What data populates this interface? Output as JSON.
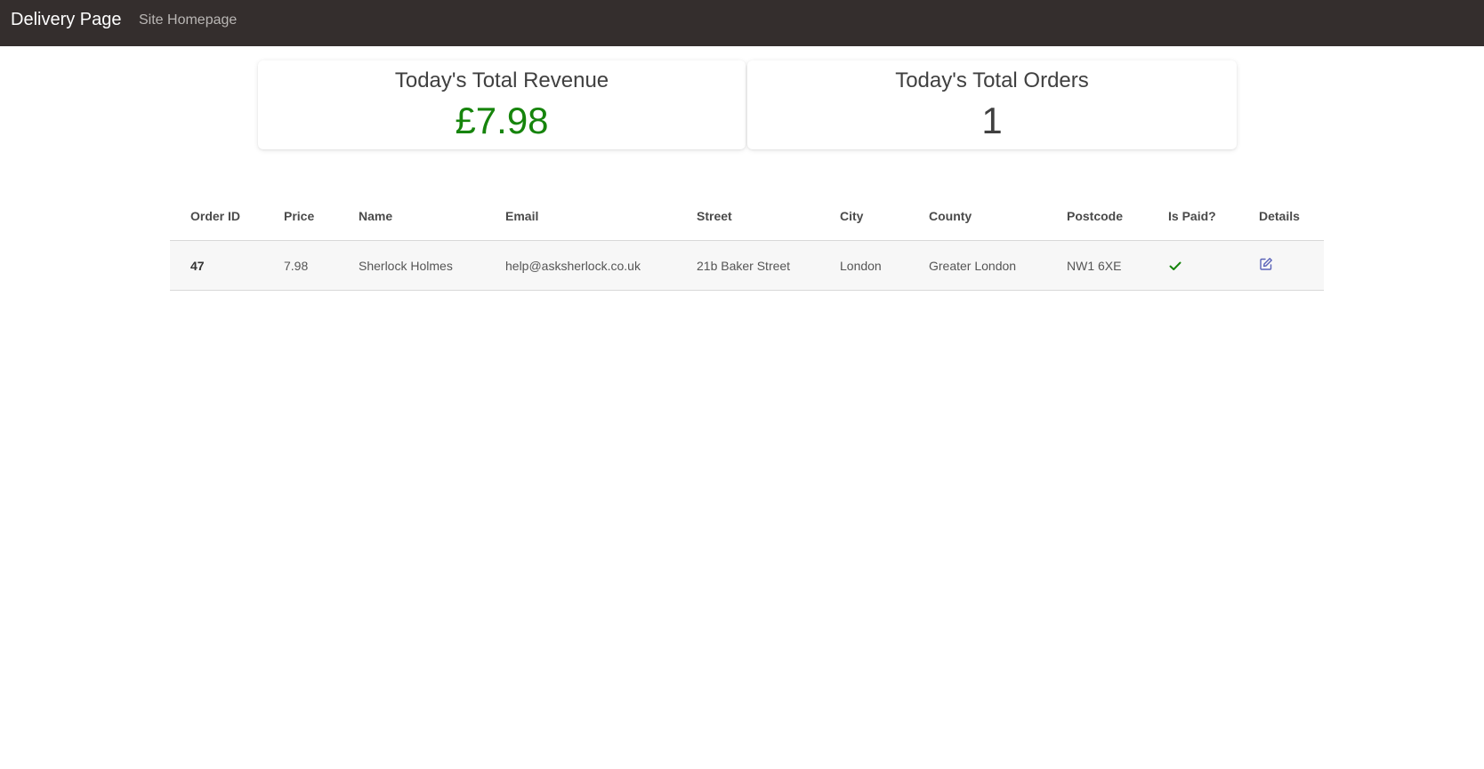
{
  "navbar": {
    "brand": "Delivery Page",
    "link_home": "Site Homepage"
  },
  "cards": {
    "revenue": {
      "title": "Today's Total Revenue",
      "value": "£7.98",
      "color": "#16840c"
    },
    "orders": {
      "title": "Today's Total Orders",
      "value": "1"
    }
  },
  "table": {
    "headers": {
      "order_id": "Order ID",
      "price": "Price",
      "name": "Name",
      "email": "Email",
      "street": "Street",
      "city": "City",
      "county": "County",
      "postcode": "Postcode",
      "is_paid": "Is Paid?",
      "details": "Details"
    },
    "rows": [
      {
        "order_id": "47",
        "price": "7.98",
        "name": "Sherlock Holmes",
        "email": "help@asksherlock.co.uk",
        "street": "21b Baker Street",
        "city": "London",
        "county": "Greater London",
        "postcode": "NW1 6XE",
        "is_paid_icon": "check-icon",
        "details_icon": "edit-icon"
      }
    ]
  },
  "colors": {
    "navbar_bg": "#342e2d",
    "paid_check": "#16840c",
    "edit_icon": "#5a63b8"
  }
}
